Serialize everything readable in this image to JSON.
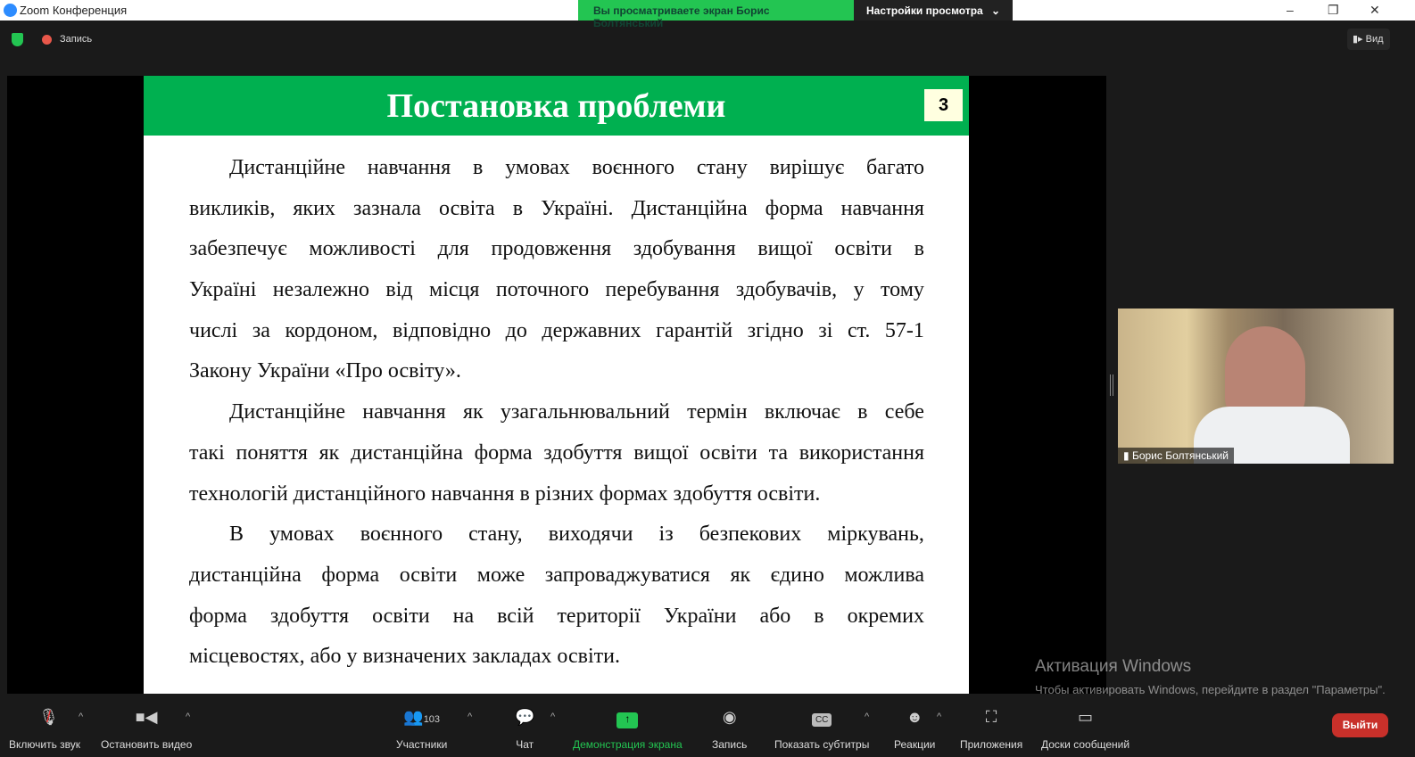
{
  "window": {
    "title": "Zoom Конференция"
  },
  "share_banner": {
    "text": "Вы просматриваете экран Борис Болтянський",
    "settings": "Настройки просмотра"
  },
  "topbar": {
    "record": "Запись",
    "view": "Вид"
  },
  "slide": {
    "title": "Постановка проблеми",
    "number": "3",
    "paragraphs": [
      [
        "Дистанційне навчання в умовах воєнного стану вирішує багато",
        "викликів, яких зазнала освіта в Україні. Дистанційна форма навчання",
        "забезпечує можливості для продовження здобування вищої освіти в",
        "Україні незалежно від  місця поточного перебування здобувачів, у тому",
        "числі за кордоном,  відповідно до державних гарантій згідно зі ст. 57-1",
        "Закону України «Про освіту»."
      ],
      [
        "Дистанційне навчання як узагальнювальний термін включає в себе",
        "такі поняття як дистанційна форма здобуття вищої освіти та використання",
        "технологій дистанційного навчання в різних формах здобуття освіти."
      ],
      [
        "В умовах воєнного стану, виходячи із безпекових міркувань,",
        "дистанційна форма освіти може запроваджуватися як єдино можлива",
        "форма здобуття освіти на всій території України або в окремих",
        "місцевостях, або у визначених закладах освіти."
      ]
    ]
  },
  "video": {
    "name": "Борис Болтянський"
  },
  "watermark": {
    "title": "Активация Windows",
    "subtitle": "Чтобы активировать Windows, перейдите в раздел \"Параметры\"."
  },
  "toolbar": {
    "unmute": "Включить звук",
    "stop_video": "Остановить видео",
    "participants": "Участники",
    "participants_count": "103",
    "chat": "Чат",
    "share": "Демонстрация экрана",
    "record": "Запись",
    "captions": "Показать субтитры",
    "reactions": "Реакции",
    "apps": "Приложения",
    "whiteboards": "Доски сообщений",
    "leave": "Выйти"
  },
  "colors": {
    "accent_green": "#23c552",
    "slide_header": "#00b050",
    "leave_red": "#c8302a"
  }
}
